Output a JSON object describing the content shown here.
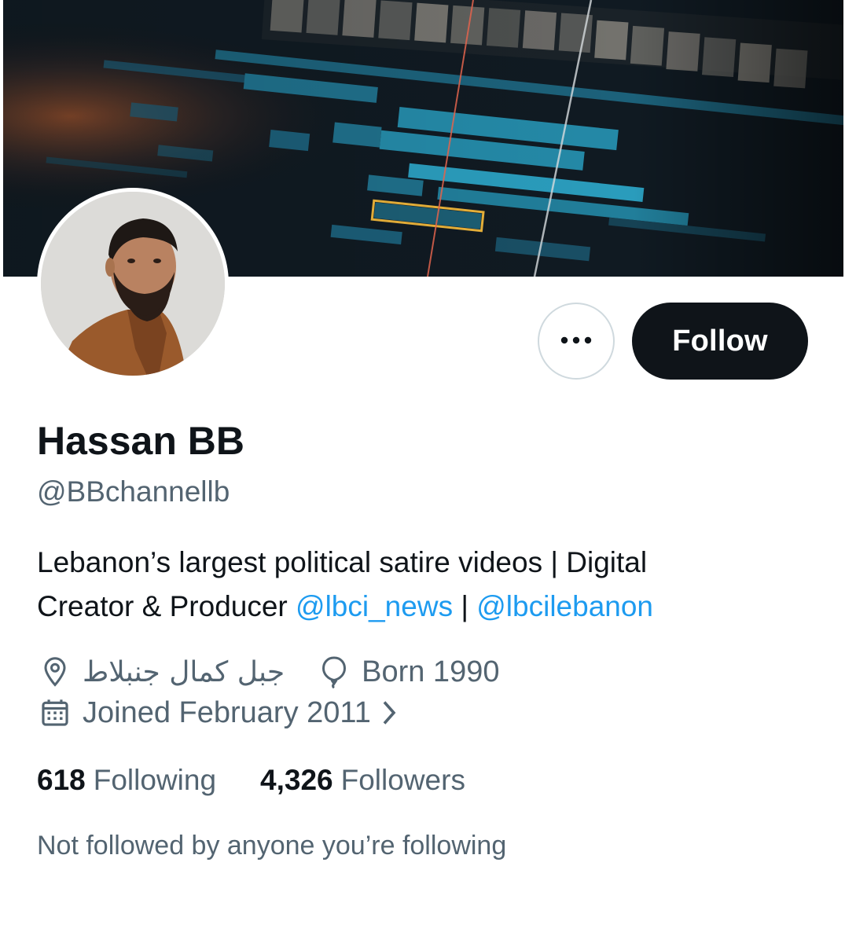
{
  "profile": {
    "display_name": "Hassan BB",
    "handle": "@BBchannellb",
    "bio": {
      "line1": "Lebanon’s largest political satire videos | Digital",
      "line2_prefix": "Creator & Producer ",
      "mention1": "@lbci_news",
      "separator": " | ",
      "mention2": "@lbcilebanon"
    },
    "location": "جبل كمال جنبلاط",
    "born": "Born 1990",
    "joined": "Joined February 2011",
    "stats": {
      "following_count": "618",
      "following_label": "Following",
      "followers_count": "4,326",
      "followers_label": "Followers"
    },
    "followed_note": "Not followed by anyone you’re following"
  },
  "actions": {
    "follow_label": "Follow",
    "more_icon": "more-horizontal-icon"
  },
  "icons": {
    "location": "location-pin-icon",
    "born": "balloon-icon",
    "joined": "calendar-icon",
    "chevron": "chevron-right-icon"
  },
  "colors": {
    "text_primary": "#0f1419",
    "text_secondary": "#536471",
    "link": "#1d9bf0",
    "follow_button_bg": "#0f1419",
    "outline": "#cfd9de"
  }
}
